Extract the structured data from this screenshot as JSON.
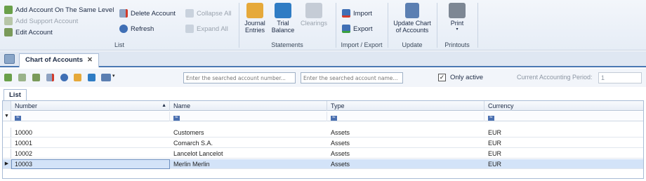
{
  "ribbon": {
    "list": {
      "add_same_level": "Add Account On The Same Level",
      "add_support": "Add Support Account",
      "edit": "Edit Account",
      "delete": "Delete Account",
      "refresh": "Refresh",
      "collapse_all": "Collapse All",
      "expand_all": "Expand All",
      "label": "List"
    },
    "statements": {
      "journal": "Journal Entries",
      "trial": "Trial Balance",
      "clearings": "Clearings",
      "label": "Statements"
    },
    "import_export": {
      "import": "Import",
      "export": "Export",
      "label": "Import / Export"
    },
    "update": {
      "update_chart": "Update Chart of Accounts",
      "label": "Update"
    },
    "printouts": {
      "print": "Print",
      "label": "Printouts"
    }
  },
  "tab": {
    "title": "Chart of Accounts",
    "close": "✕"
  },
  "toolbar": {
    "search_number_placeholder": "Enter the searched account number...",
    "search_name_placeholder": "Enter the searched account name...",
    "only_active_label": "Only active",
    "only_active_checked": "✓",
    "period_label": "Current Accounting Period:",
    "period_value": "1"
  },
  "list_tab": "List",
  "grid": {
    "columns": [
      "Number",
      "Name",
      "Type",
      "Currency"
    ],
    "sort_indicator": "▲",
    "filter_indicator": "▼",
    "filter_icon_text": "ᴮᶜ",
    "rows": [
      {
        "number": "10000",
        "name": "Customers",
        "type": "Assets",
        "currency": "EUR"
      },
      {
        "number": "10001",
        "name": "Comarch S.A.",
        "type": "Assets",
        "currency": "EUR"
      },
      {
        "number": "10002",
        "name": "Lancelot Lancelot",
        "type": "Assets",
        "currency": "EUR"
      },
      {
        "number": "10003",
        "name": "Merlin Merlin",
        "type": "Assets",
        "currency": "EUR"
      }
    ],
    "current_row_marker": "▶"
  },
  "colors": {
    "accent": "#4a78b3",
    "selected_row": "#d3e3f8"
  }
}
